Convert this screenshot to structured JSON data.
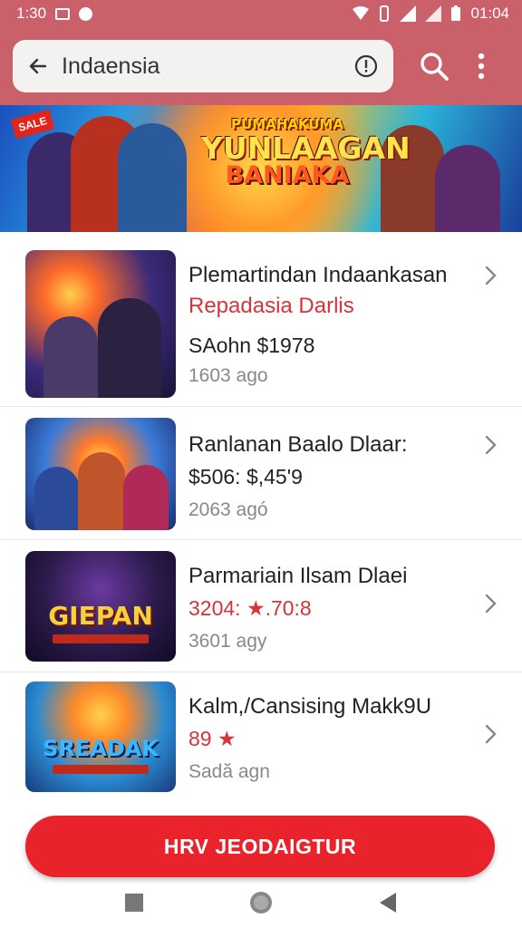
{
  "status_bar": {
    "time": "1:30",
    "clock_right": "01:04"
  },
  "search": {
    "query": "Indaensia"
  },
  "banner": {
    "top_text": "PUMAHAKUMA",
    "main_text": "YUNLAAGAN",
    "sub_text": "BANIAKA",
    "tag": "SALE"
  },
  "items": [
    {
      "title": "Plemartindan Indaankasan",
      "subtitle": "Repadasia Darlis",
      "price": "SAohn $1978",
      "time": "1603 ago"
    },
    {
      "title": "Ranlanan Baalo Dlaar:",
      "subtitle": "",
      "price": "$506: $,45'9",
      "time": "2063 agó"
    },
    {
      "title": "Parmariain Ilsam Dlaei",
      "subtitle": "",
      "price": "3204: ★.70:8",
      "time": "3601 agy",
      "thumb_label": "GIEPAN"
    },
    {
      "title": "Kalm,/Cansising Makk9U",
      "subtitle": "",
      "price": "89 ★",
      "time": "Sadă agn",
      "thumb_label": "SREADAK"
    }
  ],
  "cta": {
    "label": "HRV JEODAIGTUR"
  },
  "colors": {
    "header": "#c9606a",
    "accent": "#e8232b",
    "subtitle": "#d6333a"
  }
}
